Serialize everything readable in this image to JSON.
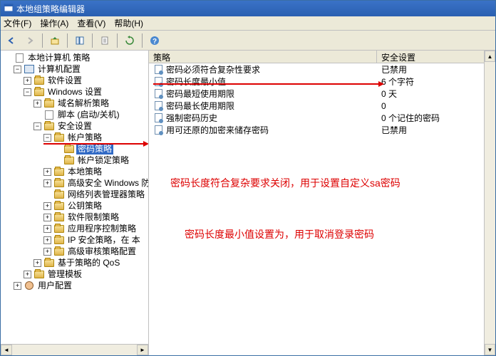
{
  "window": {
    "title": "本地组策略编辑器"
  },
  "menu": {
    "file": "文件(F)",
    "action": "操作(A)",
    "view": "查看(V)",
    "help": "帮助(H)"
  },
  "tree": {
    "root": "本地计算机 策略",
    "computer_config": "计算机配置",
    "software_settings": "软件设置",
    "windows_settings": "Windows 设置",
    "name_resolution": "域名解析策略",
    "scripts": "脚本 (启动/关机)",
    "security_settings": "安全设置",
    "account_policy": "帐户策略",
    "password_policy": "密码策略",
    "lockout_policy": "帐户锁定策略",
    "local_policy": "本地策略",
    "advanced_security": "高级安全 Windows 防",
    "network_list": "网络列表管理器策略",
    "public_key": "公钥策略",
    "software_restriction": "软件限制策略",
    "app_control": "应用程序控制策略",
    "ip_security": "IP 安全策略，在 本",
    "advanced_audit": "高级审核策略配置",
    "policy_qos": "基于策略的 QoS",
    "admin_templates": "管理模板",
    "user_config": "用户配置"
  },
  "list": {
    "col_policy": "策略",
    "col_setting": "安全设置",
    "rows": [
      {
        "policy": "密码必须符合复杂性要求",
        "setting": "已禁用"
      },
      {
        "policy": "密码长度最小值",
        "setting": "6 个字符"
      },
      {
        "policy": "密码最短使用期限",
        "setting": "0 天"
      },
      {
        "policy": "密码最长使用期限",
        "setting": "0"
      },
      {
        "policy": "强制密码历史",
        "setting": "0 个记住的密码"
      },
      {
        "policy": "用可还原的加密来储存密码",
        "setting": "已禁用"
      }
    ]
  },
  "annotations": {
    "line1": "密码长度符合复杂要求关闭，用于设置自定义sa密码",
    "line2": "密码长度最小值设置为，用于取消登录密码"
  }
}
